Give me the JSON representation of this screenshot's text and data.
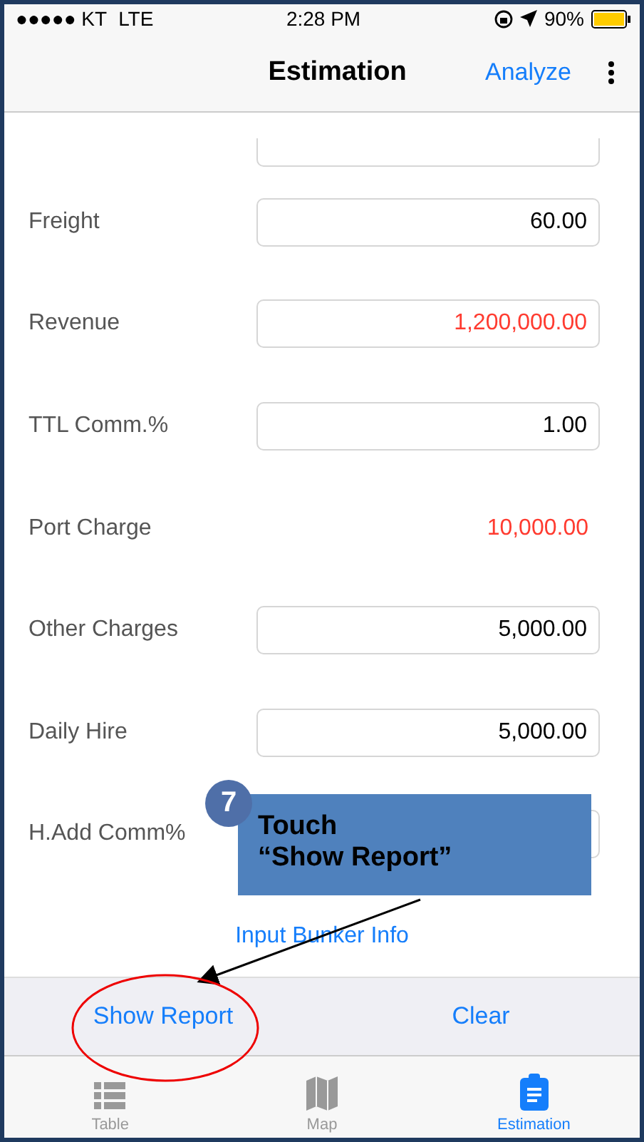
{
  "status_bar": {
    "carrier": "●●●●● KT",
    "network": "LTE",
    "time": "2:28 PM",
    "battery": "90%"
  },
  "nav": {
    "title": "Estimation",
    "action": "Analyze"
  },
  "fields": [
    {
      "label": "Freight",
      "value": "60.00",
      "kind": "input",
      "color": "#000000"
    },
    {
      "label": "Revenue",
      "value": "1,200,000.00",
      "kind": "input",
      "color": "#ff3b30"
    },
    {
      "label": "TTL Comm.%",
      "value": "1.00",
      "kind": "input",
      "color": "#000000"
    },
    {
      "label": "Port Charge",
      "value": "10,000.00",
      "kind": "plain",
      "color": "#ff3b30"
    },
    {
      "label": "Other Charges",
      "value": "5,000.00",
      "kind": "input",
      "color": "#000000"
    },
    {
      "label": "Daily Hire",
      "value": "5,000.00",
      "kind": "input",
      "color": "#000000"
    },
    {
      "label": "H.Add Comm%",
      "kind": "input"
    }
  ],
  "link": "Input Bunker Info",
  "actions": [
    "Show Report",
    "Clear"
  ],
  "tabs": [
    {
      "label": "Table",
      "selected": false
    },
    {
      "label": "Map",
      "selected": false
    },
    {
      "label": "Estimation",
      "selected": true
    }
  ],
  "callout": {
    "step": "7",
    "lines": [
      "Touch",
      "“Show Report”"
    ]
  }
}
